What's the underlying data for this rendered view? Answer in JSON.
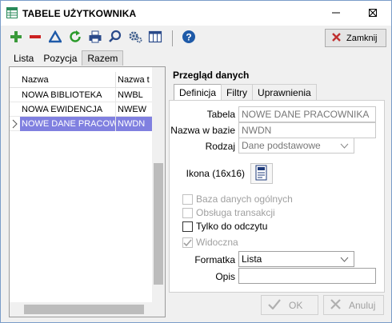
{
  "window": {
    "title": "TABELE UŻYTKOWNIKA",
    "app_icon": "table-app-icon",
    "controls": [
      {
        "name": "minimize-button",
        "icon": "minimize-icon"
      },
      {
        "name": "maximize-button",
        "icon": "maximize-icon"
      },
      {
        "name": "window-close-button",
        "icon": "close-x-icon"
      }
    ]
  },
  "toolbar": {
    "buttons": [
      {
        "name": "add-button",
        "icon": "plus-icon",
        "color": "#3a9a3a"
      },
      {
        "name": "delete-button",
        "icon": "minus-icon",
        "color": "#cc2222"
      },
      {
        "name": "edit-button",
        "icon": "triangle-icon",
        "color": "#1e5aa8"
      },
      {
        "name": "refresh-button",
        "icon": "refresh-icon",
        "color": "#2a9a2a"
      },
      {
        "name": "print-button",
        "icon": "printer-icon",
        "color": "#2a4a8a"
      },
      {
        "name": "search-button",
        "icon": "search-icon",
        "color": "#2a4a8a"
      },
      {
        "name": "settings-button",
        "icon": "gear-icon",
        "color": "#3a5a8a"
      },
      {
        "name": "columns-button",
        "icon": "columns-icon",
        "color": "#2a4a8a"
      },
      {
        "name": "help-button",
        "icon": "help-icon",
        "color": "#1e5aa8"
      }
    ],
    "close_label": "Zamknij"
  },
  "top_tabs": [
    {
      "label": "Lista",
      "active": false
    },
    {
      "label": "Pozycja",
      "active": false
    },
    {
      "label": "Razem",
      "active": true
    }
  ],
  "grid": {
    "columns": [
      "Nazwa",
      "Nazwa t"
    ],
    "rows": [
      {
        "name": "NOWA BIBLIOTEKA",
        "code": "NWBL",
        "selected": false
      },
      {
        "name": "NOWA EWIDENCJA",
        "code": "NWEW",
        "selected": false
      },
      {
        "name": "NOWE DANE PRACOWNI",
        "code": "NWDN",
        "selected": true
      }
    ],
    "selection_color": "#8080e0"
  },
  "details": {
    "title": "Przegląd danych",
    "tabs": [
      {
        "label": "Definicja",
        "active": true
      },
      {
        "label": "Filtry",
        "active": false
      },
      {
        "label": "Uprawnienia",
        "active": false
      }
    ],
    "fields": {
      "tabela_label": "Tabela",
      "tabela_value": "NOWE DANE PRACOWNIKA",
      "nazwa_label": "Nazwa w bazie",
      "nazwa_value": "NWDN",
      "rodzaj_label": "Rodzaj",
      "rodzaj_value": "Dane podstawowe",
      "ikona_label": "Ikona (16x16)",
      "formatka_label": "Formatka",
      "formatka_value": "Lista",
      "opis_label": "Opis",
      "opis_value": ""
    },
    "checkboxes": [
      {
        "label": "Baza danych ogólnych",
        "checked": false,
        "enabled": false
      },
      {
        "label": "Obsługa transakcji",
        "checked": false,
        "enabled": false
      },
      {
        "label": "Tylko do odczytu",
        "checked": false,
        "enabled": true
      },
      {
        "label": "Widoczna",
        "checked": true,
        "enabled": false
      }
    ]
  },
  "footer": {
    "ok_label": "OK",
    "cancel_label": "Anuluj"
  }
}
